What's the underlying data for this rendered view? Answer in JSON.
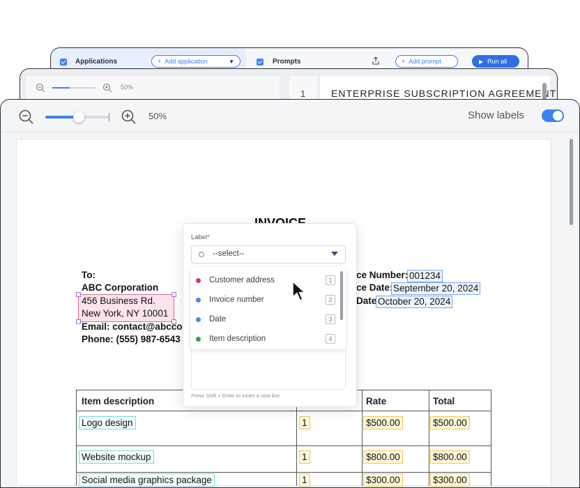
{
  "back_window": {
    "applications_label": "Applications",
    "add_application": "Add application",
    "prompts_label": "Prompts",
    "add_prompt": "Add prompt",
    "run_all": "Run all"
  },
  "mid_window": {
    "zoom_level": "50%",
    "line_number": "1",
    "doc_title": "ENTERPRISE SUBSCRIPTION AGREEMENT"
  },
  "toolbar": {
    "zoom_level": "50%",
    "show_labels": "Show labels",
    "show_labels_on": true,
    "zoom_fraction": 0.5
  },
  "invoice": {
    "title": "INVOICE",
    "to_label": "To:",
    "company": "ABC Corporation",
    "address_line1": "456 Business Rd.",
    "address_line2": "New York, NY 10001",
    "email": "Email: contact@abcco",
    "phone": "Phone: (555) 987-6543",
    "invoice_number_label": "ce Number:",
    "invoice_number": "001234",
    "invoice_date_label": "ce Date:",
    "invoice_date": "September 20, 2024",
    "due_date_label": "Date:",
    "due_date": "October 20, 2024",
    "table": {
      "headers": [
        "Item description",
        "",
        "Rate",
        "Total"
      ],
      "rows": [
        {
          "description": "Logo design",
          "qty": "1",
          "rate": "$500.00",
          "total": "$500.00"
        },
        {
          "description": "Website mockup",
          "qty": "1",
          "rate": "$800.00",
          "total": "$800.00"
        },
        {
          "description": "Social media graphics package",
          "qty": "1",
          "rate": "$300.00",
          "total": "$300.00"
        }
      ]
    }
  },
  "label_panel": {
    "label_title": "Label",
    "required_mark": "*",
    "select_placeholder": "--select--",
    "options": [
      {
        "name": "Customer address",
        "key": "1",
        "color": "#e0336e"
      },
      {
        "name": "Invoice number",
        "key": "2",
        "color": "#4f86ee"
      },
      {
        "name": "Date",
        "key": "3",
        "color": "#4f86ee"
      },
      {
        "name": "Item description",
        "key": "4",
        "color": "#2f9e52"
      }
    ],
    "hint": "Press Shift + Enter to insert a new line."
  }
}
